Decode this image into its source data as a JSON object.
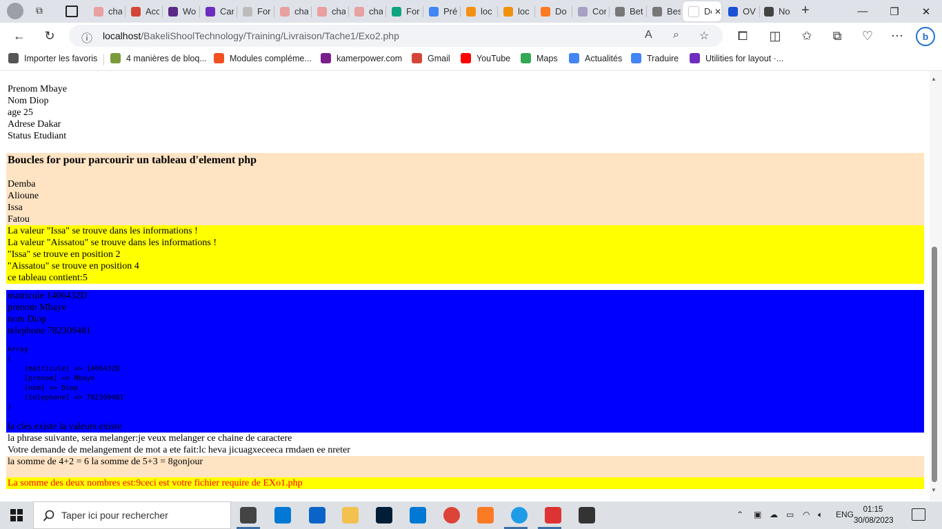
{
  "browser": {
    "tabs": [
      {
        "label": "cha",
        "color": "#e8a0a0"
      },
      {
        "label": "Acc",
        "color": "#d44638"
      },
      {
        "label": "Wo",
        "color": "#5b2a86"
      },
      {
        "label": "Car",
        "color": "#6f2dbd"
      },
      {
        "label": "For",
        "color": "#bbbbbb"
      },
      {
        "label": "cha",
        "color": "#e8a0a0"
      },
      {
        "label": "cha",
        "color": "#e8a0a0"
      },
      {
        "label": "cha",
        "color": "#e8a0a0"
      },
      {
        "label": "For",
        "color": "#10a37f"
      },
      {
        "label": "Pré",
        "color": "#4285f4"
      },
      {
        "label": "loc",
        "color": "#f29111"
      },
      {
        "label": "loc",
        "color": "#f29111"
      },
      {
        "label": "Do",
        "color": "#fb7a24"
      },
      {
        "label": "Cor",
        "color": "#a7a2c3"
      },
      {
        "label": "Bet",
        "color": "#777777"
      },
      {
        "label": "Bes",
        "color": "#777777"
      },
      {
        "label": "Doc",
        "color": "#ffffff"
      },
      {
        "label": "OV",
        "color": "#1b4fd6"
      },
      {
        "label": "No",
        "color": "#444444"
      }
    ],
    "close_tab_glyph": "✕",
    "new_tab_glyph": "+",
    "url_host": "localhost",
    "url_path": "/BakeliShoolTechnology/Training/Livraison/Tache1/Exo2.php",
    "bookmarks": [
      {
        "label": "Importer les favoris",
        "color": "#555555"
      },
      {
        "label": "4 manières de bloq...",
        "color": "#7a9b3c"
      },
      {
        "label": "Modules compléme...",
        "color": "#f25022"
      },
      {
        "label": "kamerpower.com",
        "color": "#7a1e8c"
      },
      {
        "label": "Gmail",
        "color": "#d44638"
      },
      {
        "label": "YouTube",
        "color": "#ff0000"
      },
      {
        "label": "Maps",
        "color": "#34a853"
      },
      {
        "label": "Actualités",
        "color": "#4285f4"
      },
      {
        "label": "Traduire",
        "color": "#4285f4"
      },
      {
        "label": "Utilities for layout ·...",
        "color": "#6f2dbd"
      }
    ]
  },
  "content": {
    "person": [
      "Prenom  Mbaye",
      "Nom  Diop",
      "age  25",
      "Adrese  Dakar",
      "Status  Etudiant"
    ],
    "heading": "Boucles for pour parcourir un tableau d'element php",
    "names": [
      "Demba",
      "Alioune",
      "Issa",
      "Fatou"
    ],
    "search_results": [
      "La valeur \"Issa\" se trouve dans les informations !",
      "La valeur \"Aissatou\" se trouve dans les informations !",
      "\"Issa\" se trouve en position 2",
      "\"Aissatou\" se trouve en position 4",
      "ce tableau contient:5"
    ],
    "student_fields": [
      "matricule 1406432D",
      "prenom Mbaye",
      "nom Diop",
      "telephone 782309481"
    ],
    "array_dump": "Array\n(\n    [matricule] => 1406432D\n    [prenom] => Mbaye\n    [nom] => Diop\n    [telephone] => 782309481\n)",
    "key_exists": "la cles existe la valeurs existe",
    "shuffle_line1": "la phrase suivante, sera melanger:je veux melanger ce chaine de caractere",
    "shuffle_line2": "Votre demande de melangement de mot a ete fait:lc heva jicuagxeceeca rmdaen ee nreter",
    "sums": "la somme de 4+2 = 6 la somme de 5+3 = 8gonjour",
    "require_line": "La somme des deux nombres est:9ceci est votre fichier require de EXo1.php",
    "colors": {
      "peach": "#ffe4c4",
      "yellow": "#ffff00",
      "blue": "#0000ff",
      "red": "#ff0000"
    }
  },
  "taskbar": {
    "search_placeholder": "Taper ici pour rechercher",
    "language": "ENG",
    "time": "01:15",
    "date": "30/08/2023",
    "apps": [
      {
        "name": "task-view",
        "color": "#444444"
      },
      {
        "name": "microsoft-store",
        "color": "#0078d4"
      },
      {
        "name": "mail",
        "color": "#0a64c8"
      },
      {
        "name": "file-explorer",
        "color": "#f2c14e"
      },
      {
        "name": "photoshop",
        "color": "#001e36"
      },
      {
        "name": "vscode",
        "color": "#0078d4"
      },
      {
        "name": "chrome",
        "color": "#db4437"
      },
      {
        "name": "xampp",
        "color": "#fb7a24"
      },
      {
        "name": "edge",
        "color": "#1f9ce8"
      },
      {
        "name": "terminal-app",
        "color": "#d33"
      },
      {
        "name": "media-player",
        "color": "#333333"
      }
    ]
  }
}
